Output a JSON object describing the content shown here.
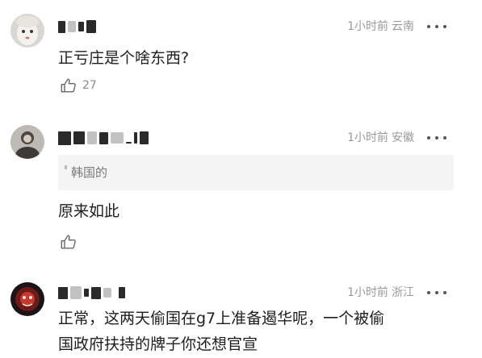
{
  "comments": [
    {
      "time": "1小时前",
      "location": "云南",
      "text": "正亏庄是个啥东西?",
      "likes": "27",
      "avatar_icon": "avatar-white-doll-icon"
    },
    {
      "time": "1小时前",
      "location": "安徽",
      "quote": "韩国的",
      "text": "原来如此",
      "likes": "",
      "avatar_icon": "avatar-person-icon"
    },
    {
      "time": "1小时前",
      "location": "浙江",
      "text_line1": "正常，这两天偷国在g7上准备遏华呢，一个被偷",
      "text_line2": "国政府扶持的牌子你还想官宣",
      "avatar_icon": "avatar-dark-red-icon"
    }
  ],
  "colors": {
    "meta_gray": "#9a9a9a",
    "text": "#1e1e1e",
    "quote_bg": "#f4f4f4"
  }
}
